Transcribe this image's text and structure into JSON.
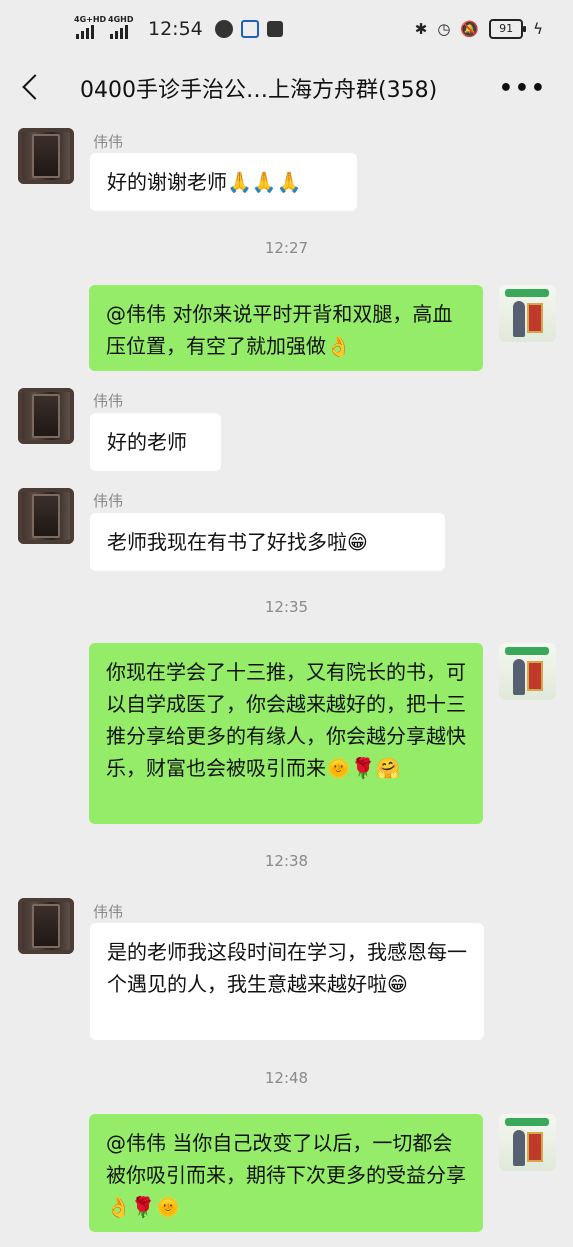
{
  "status_bar": {
    "net1": "4G+HD",
    "net2": "4GHD",
    "time": "12:54",
    "battery": "91"
  },
  "header": {
    "title": "0400手诊手治公…上海方舟群(358)",
    "more_label": "•••"
  },
  "messages": [
    {
      "sender": "伟伟",
      "text": "好的谢谢老师🙏🙏🙏"
    },
    {
      "timestamp": "12:27"
    },
    {
      "self": true,
      "text": "@伟伟  对你来说平时开背和双腿，高血压位置，有空了就加强做👌"
    },
    {
      "sender": "伟伟",
      "text": "好的老师"
    },
    {
      "sender": "伟伟",
      "text": "老师我现在有书了好找多啦😁"
    },
    {
      "timestamp": "12:35"
    },
    {
      "self": true,
      "text": "你现在学会了十三推，又有院长的书，可以自学成医了，你会越来越好的，把十三推分享给更多的有缘人，你会越分享越快乐，财富也会被吸引而来🌞🌹🤗"
    },
    {
      "timestamp": "12:38"
    },
    {
      "sender": "伟伟",
      "text": "是的老师我这段时间在学习，我感恩每一个遇见的人，我生意越来越好啦😁"
    },
    {
      "timestamp": "12:48"
    },
    {
      "self": true,
      "text": "@伟伟  当你自己改变了以后，一切都会被你吸引而来，期待下次更多的受益分享👌🌹🌞"
    }
  ]
}
